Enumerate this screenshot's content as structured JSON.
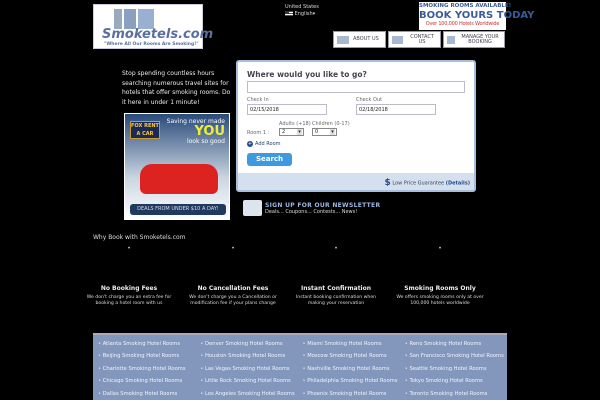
{
  "header": {
    "logo_name": "Smoketels.com",
    "logo_tagline": "\"Where All Our Rooms Are Smoking!\"",
    "country": "United States",
    "language": "English",
    "promo": {
      "line1": "SMOKING ROOMS AVAILABLE!",
      "line2": "BOOK YOURS TODAY",
      "line3": "Over 100,000 Hotels Worldwide"
    },
    "nav": [
      {
        "label": "ABOUT US"
      },
      {
        "label": "CONTACT US"
      },
      {
        "label": "MANAGE YOUR BOOKING"
      }
    ]
  },
  "intro": "Stop spending countless hours searching numerous travel sites for hotels that offer smoking rooms. Do it here in under 1 minute!",
  "ad": {
    "brand": "FOX RENT A CAR",
    "line1": "Saving never made",
    "you": "YOU",
    "line2": "look so good",
    "deal": "DEALS FROM UNDER $10 A DAY!"
  },
  "search": {
    "title": "Where would you like to go?",
    "destination": "",
    "checkin_label": "Check In",
    "checkin": "02/15/2018",
    "checkout_label": "Check Out",
    "checkout": "02/18/2018",
    "room_label": "Room 1 :",
    "adults_label": "Adults (+18)",
    "adults": "2",
    "children_label": "Children (0-17)",
    "children": "0",
    "add_room": "Add Room",
    "search_button": "Search",
    "guarantee": "Low Price Guarantee",
    "details": "(Details)"
  },
  "newsletter": {
    "title": "SIGN UP FOR OUR NEWSLETTER",
    "sub": "Deals... Coupons... Contests... News!"
  },
  "why_title": "Why Book with Smoketels.com",
  "features": [
    {
      "title": "No Booking Fees",
      "desc": "We don't charge you an extra fee for booking a hotel room with us"
    },
    {
      "title": "No Cancellation Fees",
      "desc": "We don't charge you a Cancellation or modification fee if your plans change"
    },
    {
      "title": "Instant Confirmation",
      "desc": "Instant booking confirmation when making your reservation"
    },
    {
      "title": "Smoking Rooms Only",
      "desc": "We offers smoking rooms only at over 100,000 hotels worldwide"
    }
  ],
  "cities": [
    "Atlanta Smoking Hotel Rooms",
    "Beijing Smoking Hotel Rooms",
    "Charlotte Smoking Hotel Rooms",
    "Chicago Smoking Hotel Rooms",
    "Dallas Smoking Hotel Rooms",
    "Denver Smoking Hotel Rooms",
    "Houston Smoking Hotel Rooms",
    "Las Vegas Smoking Hotel Rooms",
    "Little Rock Smoking Hotel Rooms",
    "Los Angeles Smoking Hotel Rooms",
    "Miami Smoking Hotel Rooms",
    "Moscow Smoking Hotel Rooms",
    "Nashville Smoking Hotel Rooms",
    "Philadelphia Smoking Hotel Rooms",
    "Phoenix Smoking Hotel Rooms",
    "Reno Smoking Hotel Rooms",
    "San Francisco Smoking Hotel Rooms",
    "Seattle Smoking Hotel Rooms",
    "Tokyo Smoking Hotel Rooms",
    "Toronto Smoking Hotel Rooms"
  ]
}
